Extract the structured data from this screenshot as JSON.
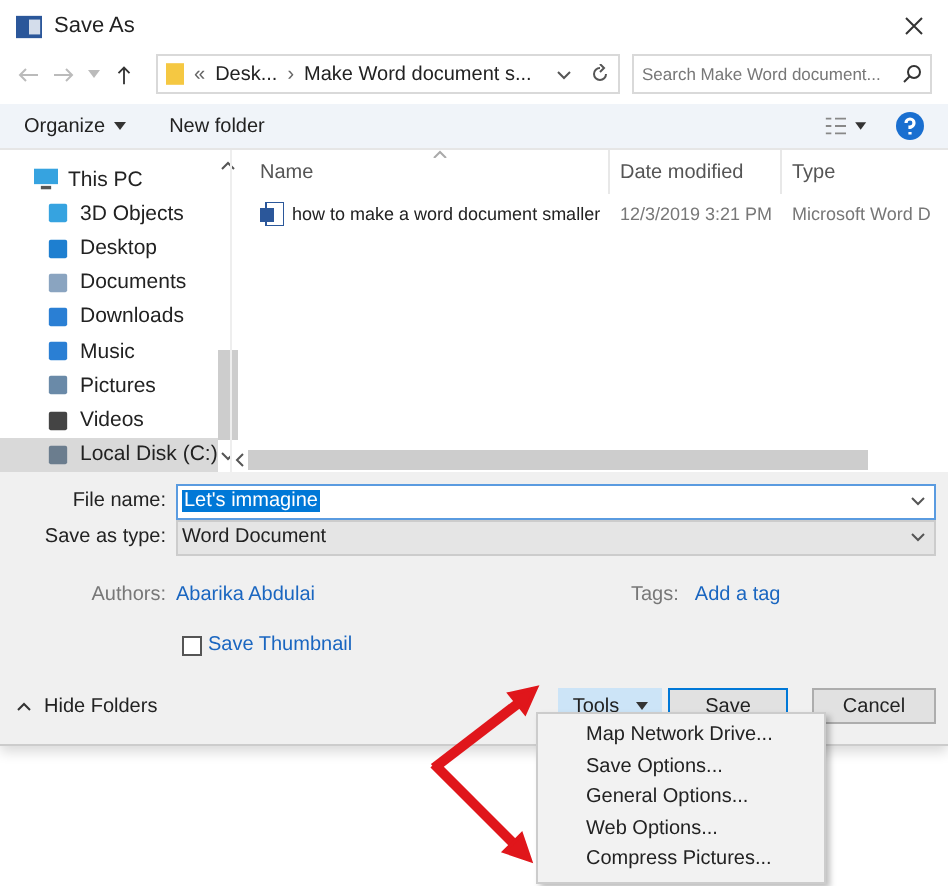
{
  "window": {
    "title": "Save As"
  },
  "address": {
    "overflow": "«",
    "separator": "›",
    "crumbs": [
      "Desk...",
      "Make Word document s..."
    ]
  },
  "search": {
    "placeholder": "Search Make Word document..."
  },
  "toolbar": {
    "organize": "Organize",
    "new_folder": "New folder"
  },
  "sidebar": {
    "items": [
      {
        "label": "This PC",
        "selected": false,
        "children": [
          {
            "label": "3D Objects",
            "selected": false
          },
          {
            "label": "Desktop",
            "selected": false
          },
          {
            "label": "Documents",
            "selected": false
          },
          {
            "label": "Downloads",
            "selected": false
          },
          {
            "label": "Music",
            "selected": false
          },
          {
            "label": "Pictures",
            "selected": false
          },
          {
            "label": "Videos",
            "selected": false
          },
          {
            "label": "Local Disk (C:)",
            "selected": true
          }
        ]
      }
    ]
  },
  "table": {
    "columns": [
      "Name",
      "Date modified",
      "Type"
    ],
    "rows": [
      {
        "name": "how to make a word document smaller",
        "date": "12/3/2019 3:21 PM",
        "type": "Microsoft Word D"
      }
    ]
  },
  "form": {
    "file_name_label": "File name:",
    "file_name": "Let's immagine",
    "type_label": "Save as type:",
    "type": "Word Document",
    "authors_label": "Authors:",
    "authors": "Abarika Abdulai",
    "tags_label": "Tags:",
    "tags": "Add a tag",
    "thumbnail": {
      "label": "Save Thumbnail",
      "checked": false
    }
  },
  "footer": {
    "hide_folders": "Hide Folders",
    "tools": "Tools",
    "save": "Save",
    "cancel": "Cancel"
  },
  "menu": {
    "items": [
      "Map Network Drive...",
      "Save Options...",
      "General Options...",
      "Web Options...",
      "Compress Pictures..."
    ]
  }
}
